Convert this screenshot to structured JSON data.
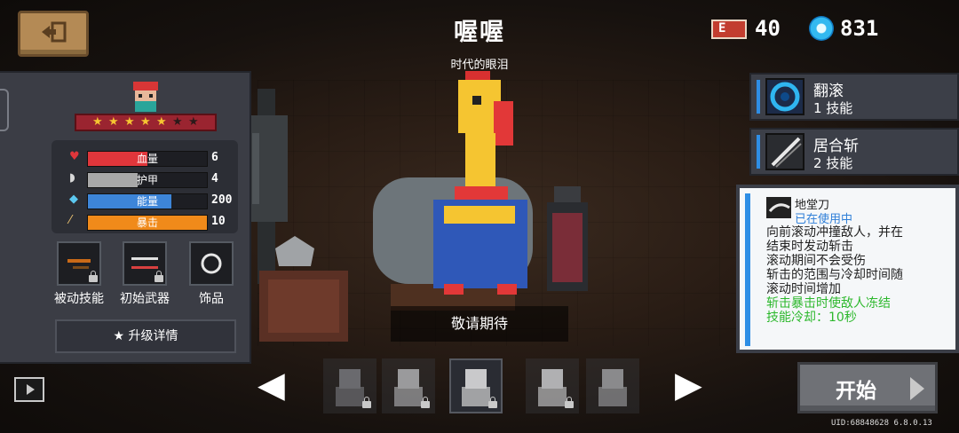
{
  "header": {
    "title": "喔喔",
    "subtitle": "时代的眼泪",
    "energy_icon_text": "E",
    "energy_value": "40",
    "gem_value": "831"
  },
  "hero": {
    "stars_filled": 5,
    "stars_total": 7,
    "stats": [
      {
        "label": "血量",
        "value": "6",
        "fill_pct": 50,
        "color": "#e0363b",
        "icon": "heart-icon"
      },
      {
        "label": "护甲",
        "value": "4",
        "fill_pct": 42,
        "color": "#a8a8a8",
        "icon": "shield-icon"
      },
      {
        "label": "能量",
        "value": "200",
        "fill_pct": 70,
        "color": "#3d85d8",
        "icon": "energy-crystal-icon"
      },
      {
        "label": "暴击",
        "value": "10",
        "fill_pct": 100,
        "color": "#f08a1a",
        "icon": "crit-blade-icon"
      }
    ],
    "slots": [
      {
        "label": "被动技能",
        "icon": "passive-skill-icon",
        "locked": true
      },
      {
        "label": "初始武器",
        "icon": "starting-weapon-icon",
        "locked": true
      },
      {
        "label": "饰品",
        "icon": "ring-icon",
        "locked": false
      }
    ],
    "upgrade_label": "★ 升级详情"
  },
  "center": {
    "coming_soon": "敬请期待"
  },
  "skills": [
    {
      "name": "翻滚",
      "sub": "1 技能",
      "icon": "roll-skill-icon"
    },
    {
      "name": "居合斩",
      "sub": "2 技能",
      "icon": "iai-slash-skill-icon"
    }
  ],
  "skill_detail": {
    "title": "地堂刀",
    "status": "已在使用中",
    "lines": [
      "向前滚动冲撞敌人，并在",
      "结束时发动斩击",
      "滚动期间不会受伤",
      "斩击的范围与冷却时间随",
      "滚动时间增加"
    ],
    "green_lines": [
      "斩击暴击时使敌人冻结",
      "技能冷却：10秒"
    ]
  },
  "carousel": {
    "prev_arrow": "◀",
    "next_arrow": "▶",
    "thumbs": [
      {
        "name": "hooded-character",
        "locked": true,
        "active": false
      },
      {
        "name": "armored-character",
        "locked": true,
        "active": false
      },
      {
        "name": "rubber-chicken-character",
        "locked": true,
        "active": true
      },
      {
        "name": "box-character",
        "locked": true,
        "active": false
      },
      {
        "name": "ghost-character",
        "locked": false,
        "active": false
      }
    ]
  },
  "start_label": "开始",
  "uid_text": "UID:68848628 6.8.0.13",
  "colors": {
    "accent_blue": "#2e8ee5",
    "ribbon_red": "#9a2430",
    "green_text": "#2db82d"
  }
}
